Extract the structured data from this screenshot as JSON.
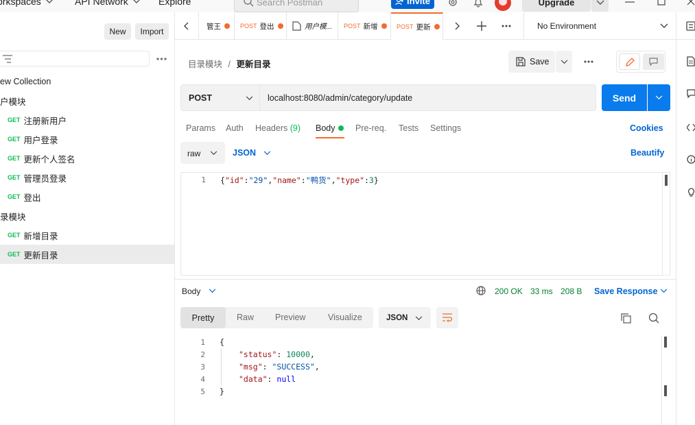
{
  "topbar": {
    "workspaces": "orkspaces",
    "api_network": "API Network",
    "explore": "Explore",
    "search_placeholder": "Search Postman",
    "invite": "Invite",
    "upgrade": "Upgrade"
  },
  "sidebar": {
    "new_label": "New",
    "import_label": "Import",
    "items": [
      {
        "label": "ew Collection"
      },
      {
        "label": "户模块"
      },
      {
        "method": "GET",
        "label": "注册新用户"
      },
      {
        "method": "GET",
        "label": "用户登录"
      },
      {
        "method": "GET",
        "label": "更新个人签名"
      },
      {
        "method": "GET",
        "label": "管理员登录"
      },
      {
        "method": "GET",
        "label": "登出"
      },
      {
        "label": "录模块"
      },
      {
        "method": "GET",
        "label": "新增目录"
      },
      {
        "method": "GET",
        "label": "更新目录"
      }
    ]
  },
  "tabs": [
    {
      "method": "",
      "label": "管王"
    },
    {
      "method": "POST",
      "label": "登出"
    },
    {
      "method": "",
      "label": "用户模..."
    },
    {
      "method": "POST",
      "label": "新增"
    },
    {
      "method": "POST",
      "label": "更新"
    }
  ],
  "environment": "No Environment",
  "breadcrumb": {
    "parent": "目录模块",
    "separator": "/",
    "current": "更新目录"
  },
  "save_label": "Save",
  "request": {
    "method": "POST",
    "url": "localhost:8080/admin/category/update",
    "send": "Send"
  },
  "req_tabs": {
    "params": "Params",
    "auth": "Auth",
    "headers": "Headers",
    "headers_count": "(9)",
    "body": "Body",
    "prereq": "Pre-req.",
    "tests": "Tests",
    "settings": "Settings",
    "cookies": "Cookies"
  },
  "body_mode": {
    "raw": "raw",
    "json": "JSON",
    "beautify": "Beautify"
  },
  "request_body": {
    "line": "1",
    "open": "{",
    "k1": "\"id\"",
    "v1": "\"29\"",
    "k2": "\"name\"",
    "v2": "\"鸭货\"",
    "k3": "\"type\"",
    "v3": "3",
    "close": "}",
    "colon": ":",
    "comma": ","
  },
  "response": {
    "body_label": "Body",
    "status": "200 OK",
    "time": "33 ms",
    "size": "208 B",
    "save_response": "Save Response",
    "view_tabs": [
      "Pretty",
      "Raw",
      "Preview",
      "Visualize"
    ],
    "format": "JSON",
    "line_numbers": [
      "1",
      "2",
      "3",
      "4",
      "5"
    ],
    "open": "{",
    "status_key": "\"status\"",
    "status_val": "10000",
    "msg_key": "\"msg\"",
    "msg_val": "\"SUCCESS\"",
    "data_key": "\"data\"",
    "data_val": "null",
    "close": "}",
    "colon": ": ",
    "comma": ","
  },
  "colors": {
    "accent": "#0265d2",
    "send": "#097bed",
    "orange": "#f16c2e",
    "green": "#0cbb52",
    "status_green": "#007f31"
  }
}
